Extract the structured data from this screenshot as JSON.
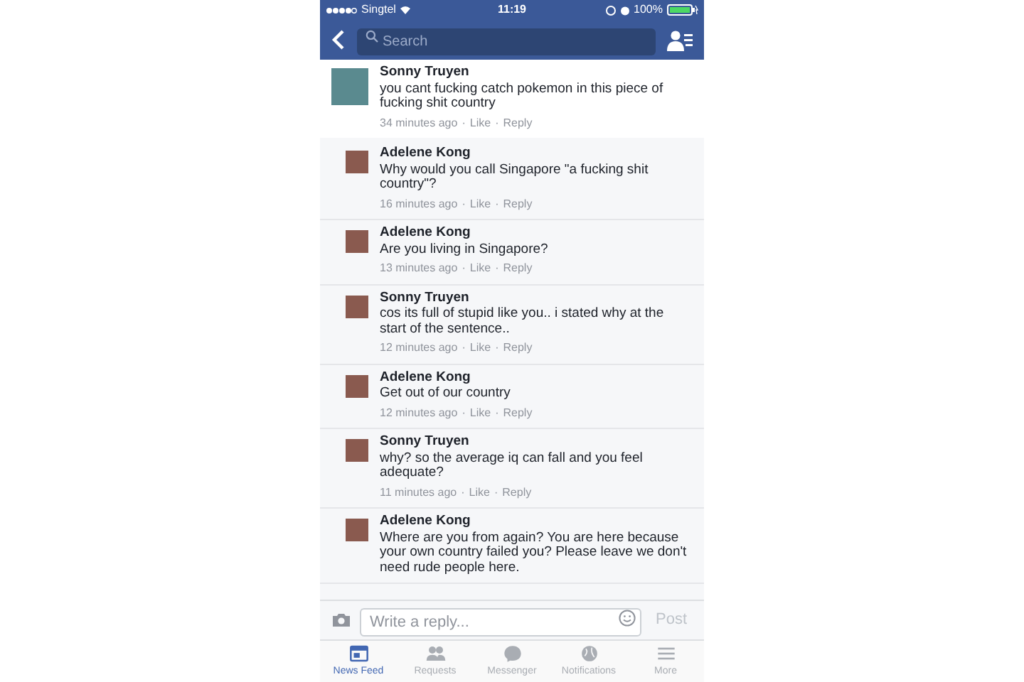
{
  "status_bar": {
    "carrier": "Singtel",
    "time": "11:19",
    "battery": "100%"
  },
  "nav": {
    "search": {
      "placeholder": "Search"
    }
  },
  "comments": [
    {
      "kind": "top",
      "author": "Sonny Truyen",
      "text": "you cant fucking catch pokemon in this piece of fucking shit country",
      "meta": [
        "34 minutes ago",
        "·",
        "Like",
        "·",
        "Reply"
      ]
    },
    {
      "kind": "reply",
      "author": "Adelene Kong",
      "text": "Why would you call Singapore \"a fucking shit country\"?",
      "meta": [
        "16 minutes ago",
        "·",
        "Like",
        "·",
        "Reply"
      ]
    },
    {
      "kind": "reply",
      "author": "Adelene Kong",
      "text": "Are you living in Singapore?",
      "meta": [
        "13 minutes ago",
        "·",
        "Like",
        "·",
        "Reply"
      ]
    },
    {
      "kind": "reply",
      "author": "Sonny Truyen",
      "text": "cos its full of stupid like you.. i stated why at the start of the sentence..",
      "meta": [
        "12 minutes ago",
        "·",
        "Like",
        "·",
        "Reply"
      ]
    },
    {
      "kind": "reply",
      "author": "Adelene Kong",
      "text": "Get out of our country",
      "meta": [
        "12 minutes ago",
        "·",
        "Like",
        "·",
        "Reply"
      ]
    },
    {
      "kind": "reply",
      "author": "Sonny Truyen",
      "text": "why? so the average iq can fall and you feel adequate?",
      "meta": [
        "11 minutes ago",
        "·",
        "Like",
        "·",
        "Reply"
      ]
    },
    {
      "kind": "reply",
      "author": "Adelene Kong",
      "text": "Where are you from again? You are here because your own country failed you? Please leave we don't need rude people here."
    }
  ],
  "composer": {
    "placeholder": "Write a reply...",
    "post": "Post"
  },
  "tabs": [
    {
      "label": "News Feed",
      "selected": true
    },
    {
      "label": "Requests",
      "selected": false
    },
    {
      "label": "Messenger",
      "selected": false
    },
    {
      "label": "Notifications",
      "selected": false
    },
    {
      "label": "More",
      "selected": false
    }
  ]
}
